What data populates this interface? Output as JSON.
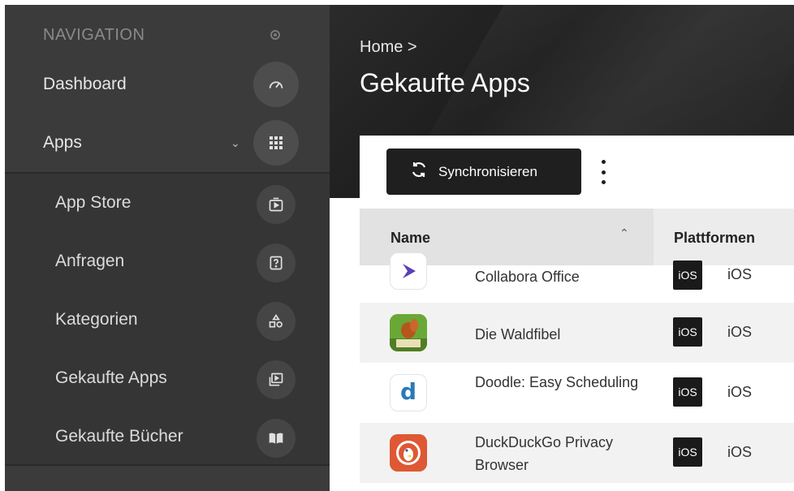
{
  "sidebar": {
    "header": "NAVIGATION",
    "items": [
      {
        "label": "Dashboard",
        "icon": "gauge-icon"
      },
      {
        "label": "Apps",
        "icon": "grid-icon"
      },
      {
        "label": "App Store",
        "icon": "play-box-icon"
      },
      {
        "label": "Anfragen",
        "icon": "question-box-icon"
      },
      {
        "label": "Kategorien",
        "icon": "shapes-icon"
      },
      {
        "label": "Gekaufte Apps",
        "icon": "stacked-play-icon"
      },
      {
        "label": "Gekaufte Bücher",
        "icon": "book-icon"
      }
    ]
  },
  "header": {
    "breadcrumb": "Home >",
    "title": "Gekaufte Apps"
  },
  "toolbar": {
    "sync_label": "Synchronisieren"
  },
  "table": {
    "columns": [
      "Name",
      "Plattformen"
    ],
    "rows": [
      {
        "name": "Collabora Office",
        "badge": "iOS",
        "platform": "iOS"
      },
      {
        "name": "Die Waldfibel",
        "badge": "iOS",
        "platform": "iOS"
      },
      {
        "name": "Doodle: Easy Scheduling",
        "badge": "iOS",
        "platform": "iOS"
      },
      {
        "name": "DuckDuckGo Privacy Browser",
        "badge": "iOS",
        "platform": "iOS"
      }
    ]
  },
  "colors": {
    "sidebar_bg": "#3b3b3b",
    "button_bg": "#1f1f1f",
    "duckduckgo": "#de5833",
    "doodle": "#2a7ab8",
    "collabora": "#5b3fb3"
  }
}
